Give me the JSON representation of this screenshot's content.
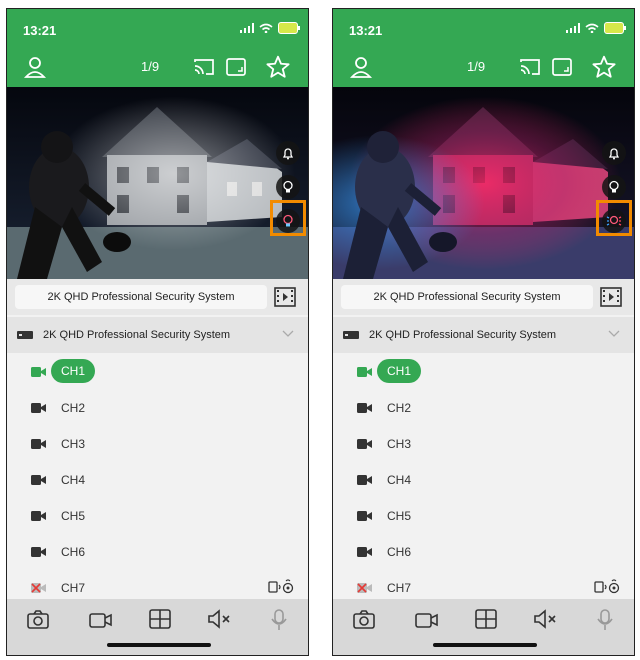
{
  "status": {
    "time": "13:21"
  },
  "nav": {
    "page": "1/9"
  },
  "device": {
    "name": "2K QHD Professional Security System"
  },
  "channels": [
    {
      "label": "CH1",
      "active": true
    },
    {
      "label": "CH2",
      "active": false
    },
    {
      "label": "CH3",
      "active": false
    },
    {
      "label": "CH4",
      "active": false
    },
    {
      "label": "CH5",
      "active": false
    },
    {
      "label": "CH6",
      "active": false
    },
    {
      "label": "CH7",
      "active": false
    }
  ],
  "colors": {
    "brand": "#34a853",
    "highlight": "#f28b00"
  },
  "icons": [
    "user-icon",
    "cast-icon",
    "screen-icon",
    "star-icon",
    "bell-icon",
    "bulb-icon",
    "colorful-light-icon",
    "film-icon",
    "dvr-icon",
    "chevron-down-icon",
    "camera-icon",
    "video-icon",
    "grid-icon",
    "mute-icon",
    "mic-icon"
  ]
}
